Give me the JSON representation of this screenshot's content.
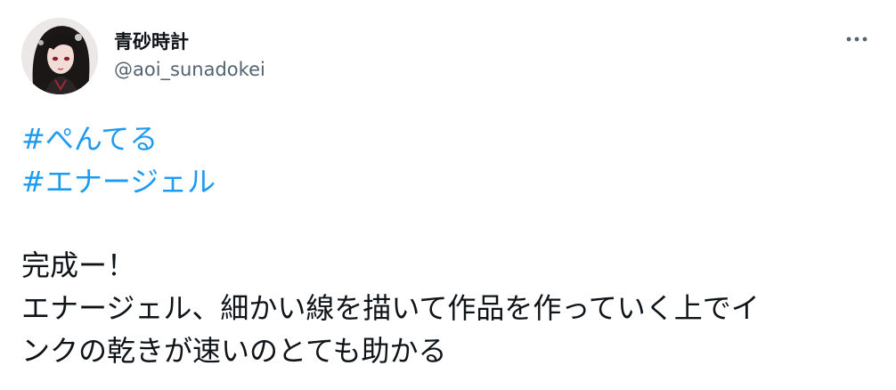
{
  "author": {
    "display_name": "青砂時計",
    "handle": "@aoi_sunadokei",
    "avatar_icon": "avatar-portrait-icon"
  },
  "menu": {
    "more_icon": "more-options-icon"
  },
  "tweet": {
    "hashtags": [
      "#ぺんてる",
      "#エナージェル"
    ],
    "body_lines": [
      "完成ー！",
      "エナージェル、細かい線を描いて作品を作っていく上でイ",
      "ンクの乾きが速いのとても助かる"
    ]
  },
  "colors": {
    "link": "#1d9bf0",
    "text": "#0f1419",
    "secondary": "#536471"
  }
}
